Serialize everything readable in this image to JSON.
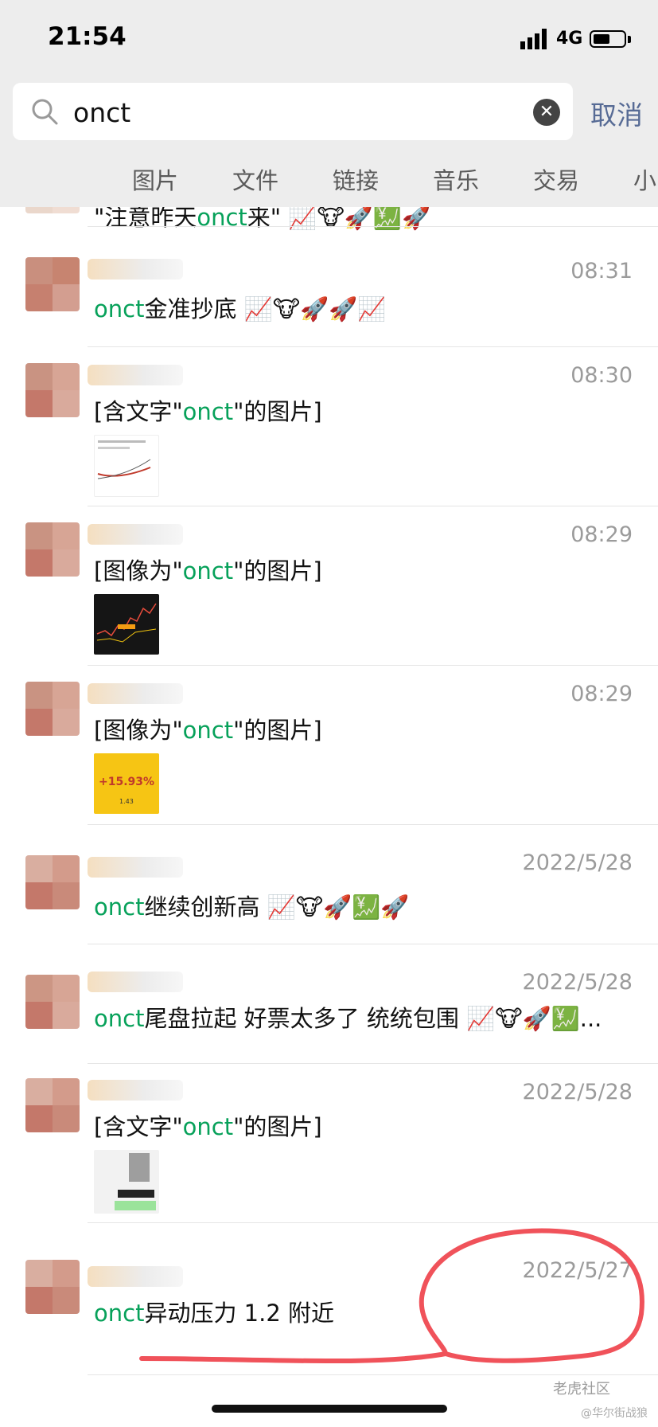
{
  "status_bar": {
    "time": "21:54",
    "network": "4G"
  },
  "search": {
    "query": "onct",
    "cancel_label": "取消"
  },
  "tabs": [
    "图片",
    "文件",
    "链接",
    "音乐",
    "交易",
    "小"
  ],
  "results": [
    {
      "timestamp": "",
      "parts": [
        "\"注意昨天",
        "onct",
        "来\" 📈🐮🚀💹🚀"
      ]
    },
    {
      "timestamp": "08:31",
      "parts": [
        "",
        "onct",
        "金准抄底 📈🐮🚀🚀📈"
      ]
    },
    {
      "timestamp": "08:30",
      "parts": [
        "[含文字\"",
        "onct",
        "\"的图片]"
      ]
    },
    {
      "timestamp": "08:29",
      "parts": [
        "[图像为\"",
        "onct",
        "\"的图片]"
      ]
    },
    {
      "timestamp": "08:29",
      "parts": [
        "[图像为\"",
        "onct",
        "\"的图片]"
      ]
    },
    {
      "timestamp": "2022/5/28",
      "parts": [
        "",
        "onct",
        "继续创新高 📈🐮🚀💹🚀"
      ]
    },
    {
      "timestamp": "2022/5/28",
      "parts": [
        "",
        "onct",
        "尾盘拉起 好票太多了 统统包围 📈🐮🚀💹..."
      ]
    },
    {
      "timestamp": "2022/5/28",
      "parts": [
        "[含文字\"",
        "onct",
        "\"的图片]"
      ]
    },
    {
      "timestamp": "2022/5/27",
      "parts": [
        "",
        "onct",
        "异动压力 1.2 附近"
      ]
    }
  ],
  "thumbnail_texts": {
    "gain": "+15.93%",
    "small": "1.43"
  },
  "watermark": {
    "brand": "老虎社区",
    "handle": "@华尔街战狼"
  },
  "colors": {
    "highlight": "#07a15a",
    "cancel": "#576b95",
    "annotation": "#f0525a"
  }
}
